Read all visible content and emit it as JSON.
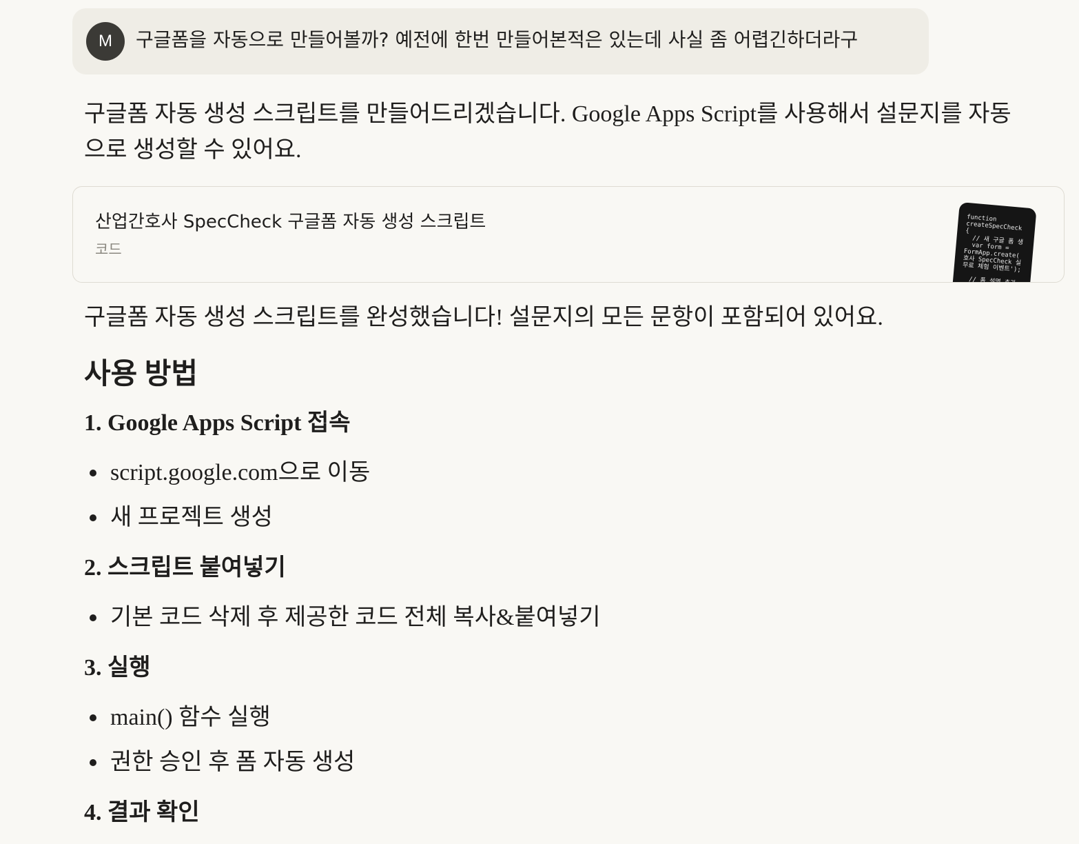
{
  "user_message": {
    "avatar_initial": "M",
    "text": "구글폼을 자동으로 만들어볼까? 예전에 한번 만들어본적은 있는데 사실 좀 어렵긴하더라구"
  },
  "assistant": {
    "intro": "구글폼 자동 생성 스크립트를 만들어드리겠습니다. Google Apps Script를 사용해서 설문지를 자동으로 생성할 수 있어요.",
    "artifact": {
      "title": "산업간호사 SpecCheck 구글폼 자동 생성 스크립트",
      "type_label": "코드",
      "thumbnail_code": "function\ncreateSpecCheck\n{\n  // 새 구글 폼 생\n  var form =\nFormApp.create(\n호사 SpecCheck 실\n무료 체험 이벤트');\n\n  // 폼 설명 추가"
    },
    "done_text": "구글폼 자동 생성 스크립트를 완성했습니다! 설문지의 모든 문항이 포함되어 있어요.",
    "section_heading": "사용 방법",
    "steps": [
      {
        "heading": "1. Google Apps Script 접속",
        "bullets": [
          "script.google.com으로 이동",
          "새 프로젝트 생성"
        ]
      },
      {
        "heading": "2. 스크립트 붙여넣기",
        "bullets": [
          "기본 코드 삭제 후 제공한 코드 전체 복사&붙여넣기"
        ]
      },
      {
        "heading": "3. 실행",
        "bullets": [
          "main() 함수 실행",
          "권한 승인 후 폼 자동 생성"
        ]
      },
      {
        "heading": "4. 결과 확인",
        "bullets": []
      }
    ]
  },
  "colors": {
    "page_background": "#f9f8f4",
    "user_bubble": "#efede6",
    "avatar": "#3b3a36",
    "text": "#1f1e1d",
    "muted_text": "#8a877f",
    "card_border": "#dedbd2"
  }
}
